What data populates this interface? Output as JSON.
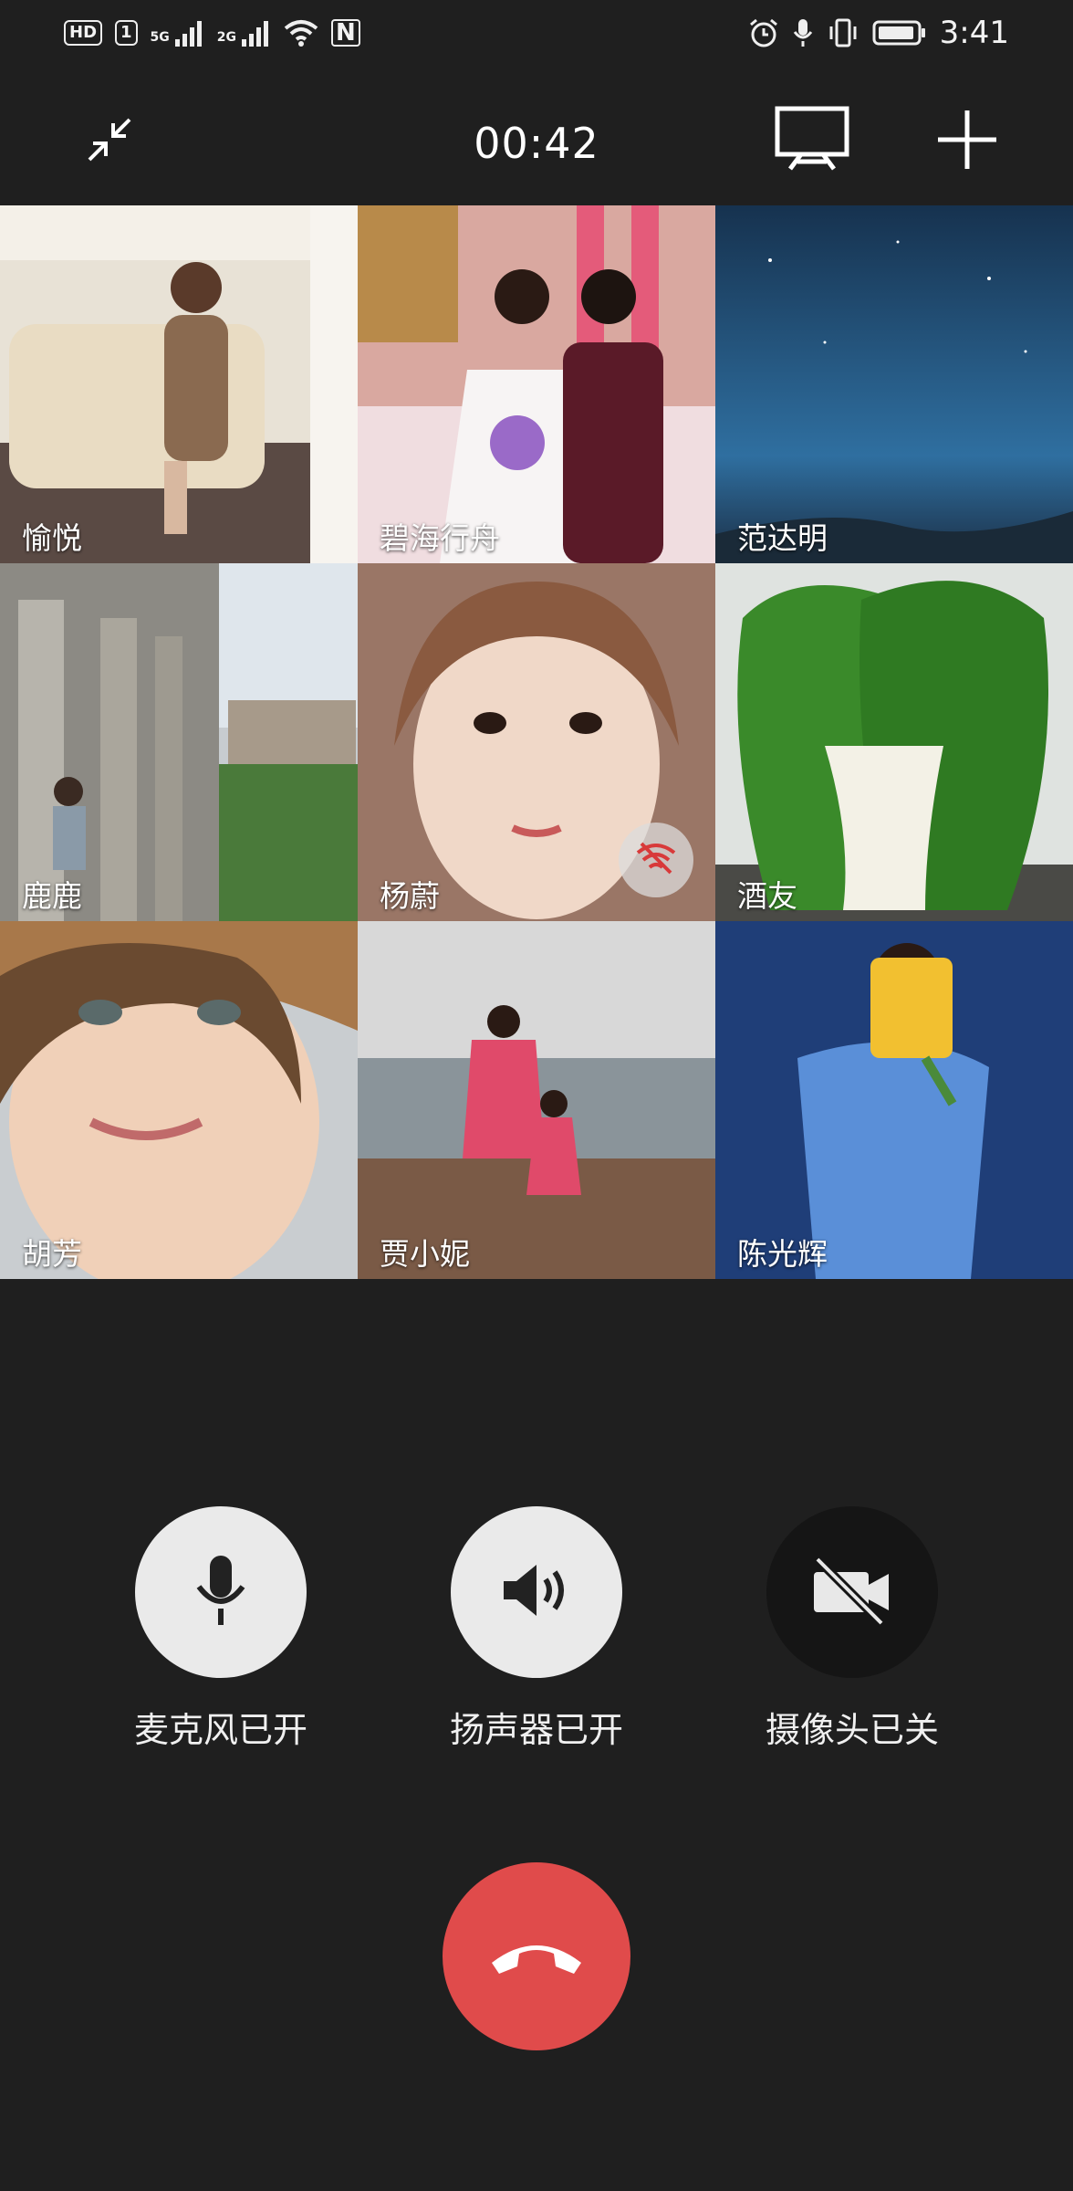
{
  "status_bar": {
    "hd_label": "HD",
    "sim_slot": "1",
    "signal1_label": "5G",
    "signal2_label": "2G",
    "nfc_label": "N",
    "time": "3:41"
  },
  "header": {
    "timer": "00:42",
    "minimize_icon": "minimize-icon",
    "screen_share_icon": "screen-share-icon",
    "add_icon": "add-participant-icon"
  },
  "participants": [
    {
      "name": "愉悦"
    },
    {
      "name": "碧海行舟"
    },
    {
      "name": "范达明"
    },
    {
      "name": "鹿鹿"
    },
    {
      "name": "杨蔚",
      "weak_network": true
    },
    {
      "name": "酒友"
    },
    {
      "name": "胡芳"
    },
    {
      "name": "贾小妮"
    },
    {
      "name": "陈光辉"
    }
  ],
  "controls": {
    "mic": {
      "label": "麦克风已开",
      "icon": "microphone-icon",
      "state": "on"
    },
    "speaker": {
      "label": "扬声器已开",
      "icon": "speaker-icon",
      "state": "on"
    },
    "camera": {
      "label": "摄像头已关",
      "icon": "camera-off-icon",
      "state": "off"
    }
  },
  "hangup": {
    "icon": "hangup-icon",
    "color": "#e04b4b"
  }
}
